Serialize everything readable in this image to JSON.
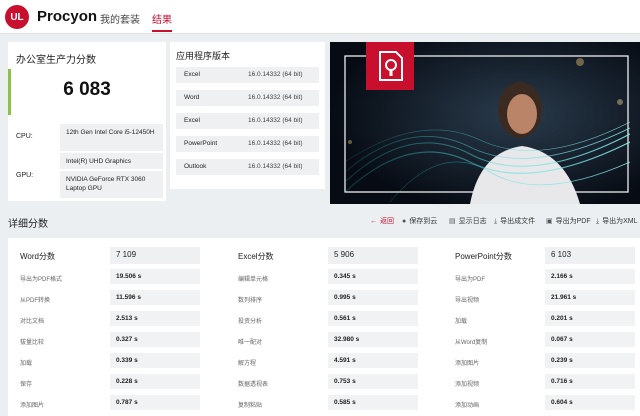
{
  "header": {
    "logo_text": "UL",
    "app_name": "Procyon",
    "nav": [
      "我的套装",
      "结果"
    ]
  },
  "score": {
    "title": "办公室生产力分数",
    "value": "6 083",
    "bar_color": "#8bc34a",
    "cpu_label": "CPU:",
    "cpu_value": "12th Gen Intel Core i5-12450H",
    "gpu_label": "GPU:",
    "gpu_values": [
      "Intel(R) UHD Graphics",
      "NVIDIA GeForce RTX 3060 Laptop GPU"
    ]
  },
  "apps": {
    "title": "应用程序版本",
    "items": [
      {
        "name": "Excel",
        "version": "16.0.14332 (64 bit)"
      },
      {
        "name": "Word",
        "version": "16.0.14332 (64 bit)"
      },
      {
        "name": "Excel",
        "version": "16.0.14332 (64 bit)"
      },
      {
        "name": "PowerPoint",
        "version": "16.0.14332 (64 bit)"
      },
      {
        "name": "Outlook",
        "version": "16.0.14332 (64 bit)"
      }
    ]
  },
  "detail": {
    "title": "详细分数",
    "actions": [
      "返回",
      "保存到云",
      "显示日志",
      "导出成文件",
      "导出为PDF",
      "导出为XML"
    ],
    "columns": [
      {
        "name": "Word分数",
        "score": "7 109",
        "rows": [
          {
            "label": "导出为PDF格式",
            "value": "19.506 s"
          },
          {
            "label": "从PDF转换",
            "value": "11.596 s"
          },
          {
            "label": "对比文档",
            "value": "2.513 s"
          },
          {
            "label": "拔量比较",
            "value": "0.327 s"
          },
          {
            "label": "加载",
            "value": "0.339 s"
          },
          {
            "label": "保存",
            "value": "0.228 s"
          },
          {
            "label": "添加图片",
            "value": "0.787 s"
          }
        ]
      },
      {
        "name": "Excel分数",
        "score": "5 906",
        "rows": [
          {
            "label": "编辑单元格",
            "value": "0.345 s"
          },
          {
            "label": "数列排序",
            "value": "0.995 s"
          },
          {
            "label": "投资分析",
            "value": "0.561 s"
          },
          {
            "label": "唯一配对",
            "value": "32.980 s"
          },
          {
            "label": "解方程",
            "value": "4.591 s"
          },
          {
            "label": "数据透视表",
            "value": "0.753 s"
          },
          {
            "label": "复制粘贴",
            "value": "0.585 s"
          }
        ]
      },
      {
        "name": "PowerPoint分数",
        "score": "6 103",
        "rows": [
          {
            "label": "导出为PDF",
            "value": "2.166 s"
          },
          {
            "label": "导出视频",
            "value": "21.961 s"
          },
          {
            "label": "加载",
            "value": "0.201 s"
          },
          {
            "label": "从Word复制",
            "value": "0.067 s"
          },
          {
            "label": "添加图片",
            "value": "0.239 s"
          },
          {
            "label": "添加视频",
            "value": "0.716 s"
          },
          {
            "label": "添加动画",
            "value": "0.604 s"
          }
        ]
      }
    ]
  },
  "colors": {
    "accent": "#c8102e",
    "panel": "#eef0f2"
  }
}
